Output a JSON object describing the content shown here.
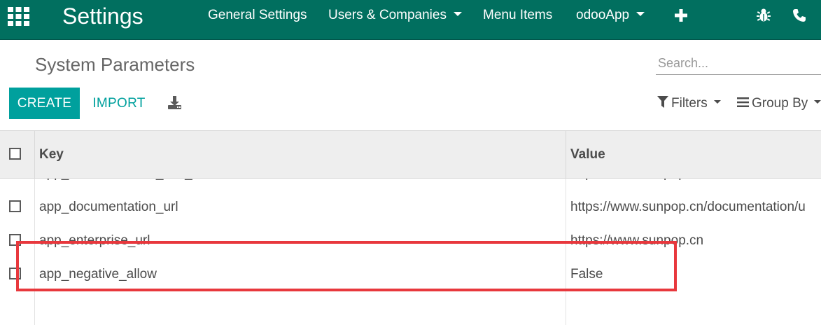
{
  "navbar": {
    "app_title": "Settings",
    "items": [
      {
        "label": "General Settings"
      },
      {
        "label": "Users & Companies"
      },
      {
        "label": "Menu Items"
      },
      {
        "label": "odooApp"
      }
    ],
    "icons": [
      "apps-grid-icon",
      "plus-icon",
      "bug-icon",
      "phone-icon"
    ],
    "color": "#016f5f"
  },
  "control_panel": {
    "breadcrumb": "System Parameters",
    "search_placeholder": "Search...",
    "create_label": "CREATE",
    "import_label": "IMPORT",
    "filters_label": "Filters",
    "group_by_label": "Group By",
    "accent_color": "#00a09d"
  },
  "table": {
    "columns": [
      "Key",
      "Value"
    ],
    "rows": [
      {
        "key": "app_documentation_dev_url",
        "value": "https://www.sunpop.cn/documentation/"
      },
      {
        "key": "app_documentation_url",
        "value": "https://www.sunpop.cn/documentation/u"
      },
      {
        "key": "app_enterprise_url",
        "value": "https://www.sunpop.cn"
      },
      {
        "key": "app_negative_allow",
        "value": "False"
      }
    ]
  },
  "annotation": {
    "highlight_color": "#e8383d"
  }
}
